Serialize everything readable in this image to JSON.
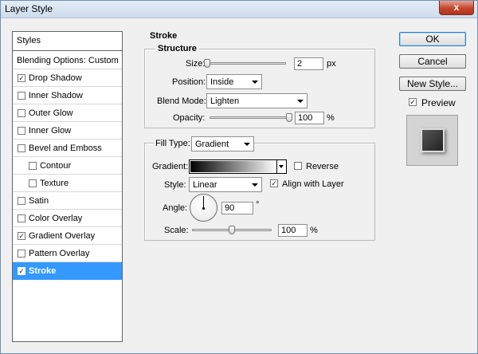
{
  "window": {
    "title": "Layer Style",
    "close_glyph": "x"
  },
  "styles_list": {
    "header": "Styles",
    "blending_options": "Blending Options: Custom",
    "items": [
      {
        "label": "Drop Shadow",
        "checked": true,
        "indent": false,
        "selected": false
      },
      {
        "label": "Inner Shadow",
        "checked": false,
        "indent": false,
        "selected": false
      },
      {
        "label": "Outer Glow",
        "checked": false,
        "indent": false,
        "selected": false
      },
      {
        "label": "Inner Glow",
        "checked": false,
        "indent": false,
        "selected": false
      },
      {
        "label": "Bevel and Emboss",
        "checked": false,
        "indent": false,
        "selected": false
      },
      {
        "label": "Contour",
        "checked": false,
        "indent": true,
        "selected": false
      },
      {
        "label": "Texture",
        "checked": false,
        "indent": true,
        "selected": false
      },
      {
        "label": "Satin",
        "checked": false,
        "indent": false,
        "selected": false
      },
      {
        "label": "Color Overlay",
        "checked": false,
        "indent": false,
        "selected": false
      },
      {
        "label": "Gradient Overlay",
        "checked": true,
        "indent": false,
        "selected": false
      },
      {
        "label": "Pattern Overlay",
        "checked": false,
        "indent": false,
        "selected": false
      },
      {
        "label": "Stroke",
        "checked": true,
        "indent": false,
        "selected": true
      }
    ]
  },
  "stroke": {
    "section_title": "Stroke",
    "structure_title": "Structure",
    "size_label": "Size:",
    "size_value": "2",
    "size_unit": "px",
    "size_slider_fraction": 0.01,
    "position_label": "Position:",
    "position_value": "Inside",
    "blend_mode_label": "Blend Mode:",
    "blend_mode_value": "Lighten",
    "opacity_label": "Opacity:",
    "opacity_value": "100",
    "opacity_unit": "%",
    "opacity_slider_fraction": 1.0,
    "fill_type_label": "Fill Type:",
    "fill_type_value": "Gradient",
    "gradient_label": "Gradient:",
    "reverse_label": "Reverse",
    "reverse_checked": false,
    "style_label": "Style:",
    "style_value": "Linear",
    "align_label": "Align with Layer",
    "align_checked": true,
    "angle_label": "Angle:",
    "angle_value": "90",
    "angle_unit": "°",
    "scale_label": "Scale:",
    "scale_value": "100",
    "scale_unit": "%",
    "scale_slider_fraction": 0.5
  },
  "buttons": {
    "ok": "OK",
    "cancel": "Cancel",
    "new_style": "New Style...",
    "preview_label": "Preview",
    "preview_checked": true
  },
  "colors": {
    "selection": "#3399ff",
    "window_bg": "#f0f0f0"
  }
}
